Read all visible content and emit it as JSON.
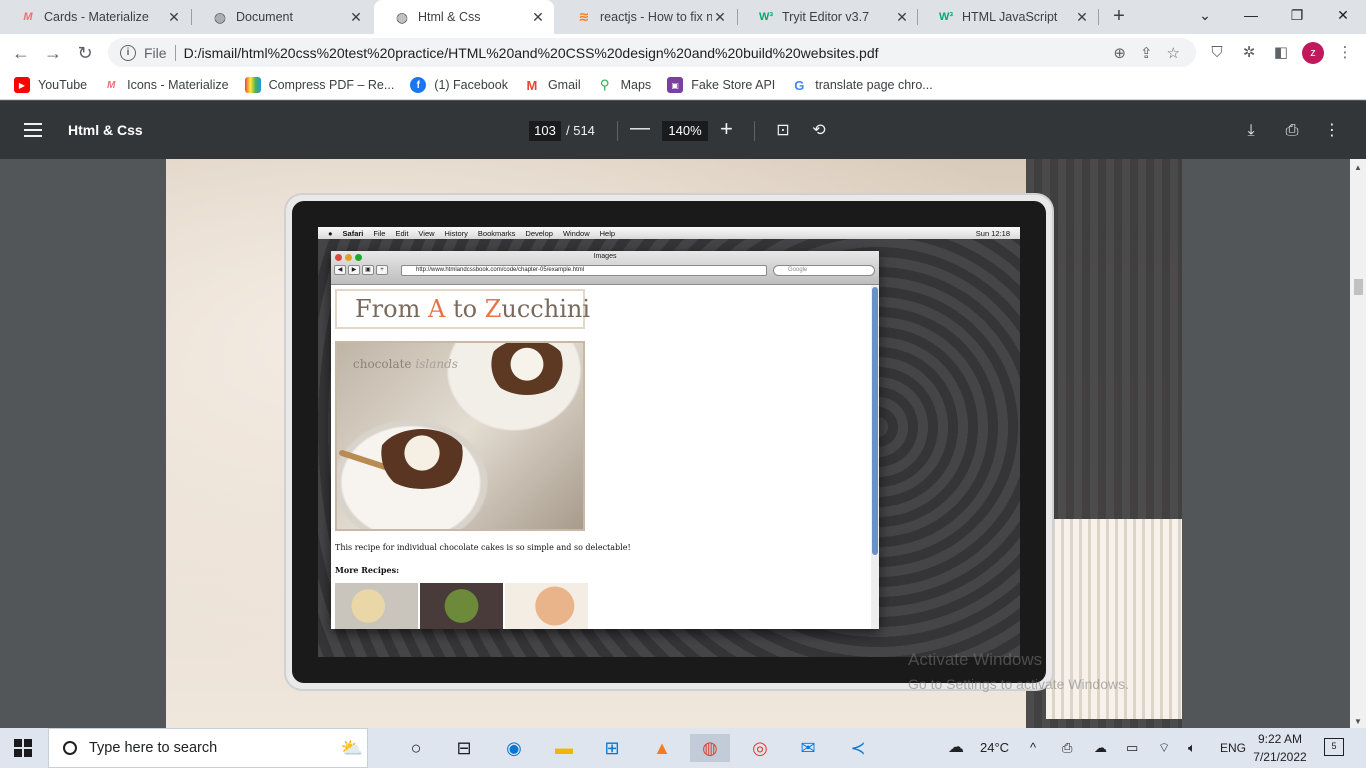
{
  "tabs": [
    {
      "title": "Cards - Materialize",
      "icon": "materialize-icon",
      "active": false
    },
    {
      "title": "Document",
      "icon": "globe-icon",
      "active": false
    },
    {
      "title": "Html & Css",
      "icon": "globe-icon",
      "active": true
    },
    {
      "title": "reactjs - How to fix no",
      "icon": "stackoverflow-icon",
      "active": false
    },
    {
      "title": "Tryit Editor v3.7",
      "icon": "w3schools-icon",
      "active": false
    },
    {
      "title": "HTML JavaScript",
      "icon": "w3schools-icon",
      "active": false
    }
  ],
  "new_tab": "+",
  "address": {
    "scheme": "File",
    "url": "D:/ismail/html%20css%20test%20practice/HTML%20and%20CSS%20design%20and%20build%20websites.pdf"
  },
  "profile_initial": "z",
  "bookmarks": [
    {
      "label": "YouTube",
      "icon": "youtube-icon",
      "color": "#ff0000"
    },
    {
      "label": "Icons - Materialize",
      "icon": "materialize-icon",
      "color": "#ee6e73"
    },
    {
      "label": "Compress PDF – Re...",
      "icon": "ilovepdf-icon",
      "color": "#4caf50"
    },
    {
      "label": "(1) Facebook",
      "icon": "facebook-icon",
      "color": "#1877f2"
    },
    {
      "label": "Gmail",
      "icon": "gmail-icon",
      "color": "#ea4335"
    },
    {
      "label": "Maps",
      "icon": "maps-icon",
      "color": "#34a853"
    },
    {
      "label": "Fake Store API",
      "icon": "fakestore-icon",
      "color": "#7b3fa0"
    },
    {
      "label": "translate page chro...",
      "icon": "google-icon",
      "color": "#4285f4"
    }
  ],
  "pdf_toolbar": {
    "title": "Html & Css",
    "current_page": "103",
    "total_pages": "/ 514",
    "zoom": "140%"
  },
  "pdf_content": {
    "mac_menu": [
      "Safari",
      "File",
      "Edit",
      "View",
      "History",
      "Bookmarks",
      "Develop",
      "Window",
      "Help"
    ],
    "mac_clock": "Sun 12:18",
    "safari_title": "Images",
    "safari_url": "http://www.htmlandcssbook.com/code/chapter-05/example.html",
    "safari_search_placeholder": "Google",
    "banner_from": "From",
    "banner_a": "A",
    "banner_to": "to",
    "banner_z": "Z",
    "banner_ucchini": "ucchini",
    "photo_caption_1": "chocolate",
    "photo_caption_2": "islands",
    "recipe_text": "This recipe for individual chocolate cakes is so simple and so delectable!",
    "more_recipes": "More Recipes:"
  },
  "watermark": {
    "line1": "Activate Windows",
    "line2": "Go to Settings to activate Windows."
  },
  "taskbar": {
    "search_placeholder": "Type here to search",
    "weather": "24°C",
    "language": "ENG",
    "time": "9:22 AM",
    "date": "7/21/2022",
    "notifications": "5"
  }
}
